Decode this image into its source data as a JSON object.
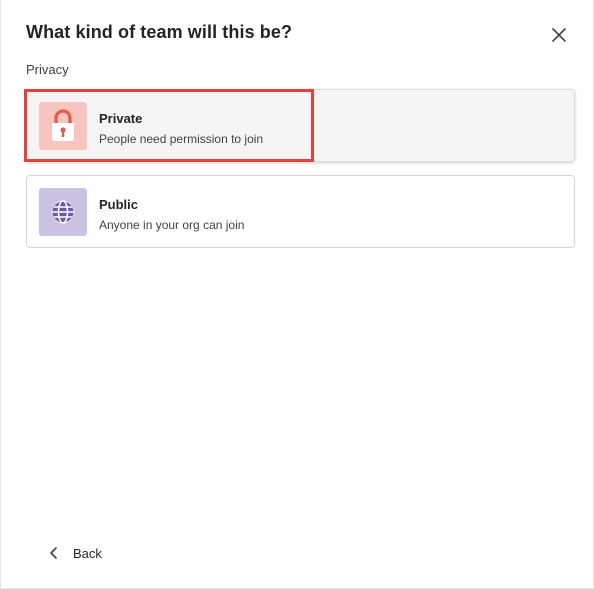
{
  "dialog": {
    "title": "What kind of team will this be?",
    "close_icon": "close-icon"
  },
  "privacy": {
    "section_label": "Privacy",
    "options": [
      {
        "title": "Private",
        "description": "People need permission to join",
        "icon": "lock-icon",
        "icon_bg": "#f7c5bd",
        "icon_color": "#e25b4b",
        "highlighted": true
      },
      {
        "title": "Public",
        "description": "Anyone in your org can join",
        "icon": "globe-icon",
        "icon_bg": "#cbc1e0",
        "icon_color": "#6b5aa8",
        "highlighted": false
      }
    ]
  },
  "footer": {
    "back_label": "Back",
    "back_icon": "chevron-left-icon"
  },
  "colors": {
    "highlight": "#e8403a"
  }
}
